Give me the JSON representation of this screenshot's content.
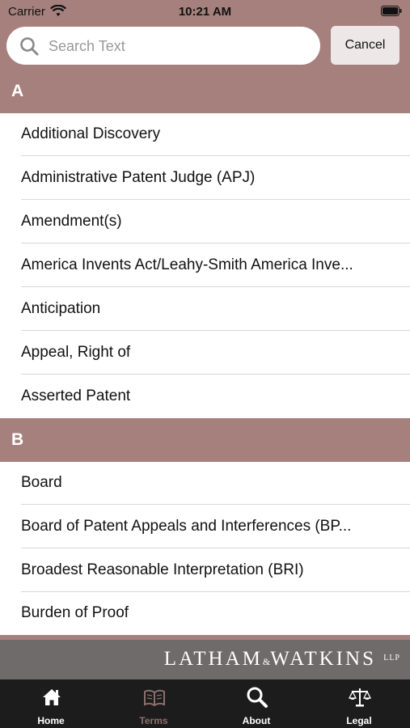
{
  "status": {
    "carrier": "Carrier",
    "time": "10:21 AM"
  },
  "search": {
    "placeholder": "Search Text",
    "value": "",
    "cancel_label": "Cancel"
  },
  "sections": [
    {
      "letter": "A",
      "items": [
        "Additional Discovery",
        "Administrative Patent Judge (APJ)",
        "Amendment(s)",
        "America Invents Act/Leahy-Smith America Inve...",
        "Anticipation",
        "Appeal, Right of",
        "Asserted Patent"
      ]
    },
    {
      "letter": "B",
      "items": [
        "Board",
        "Board of Patent Appeals and Interferences (BP...",
        "Broadest Reasonable Interpretation (BRI)",
        "Burden of Proof"
      ]
    }
  ],
  "brand": {
    "name_left": "LATHAM",
    "amp": "&",
    "name_right": "WATKINS",
    "suffix": "LLP"
  },
  "tabs": [
    {
      "label": "Home",
      "icon": "home-icon",
      "active": false
    },
    {
      "label": "Terms",
      "icon": "book-icon",
      "active": true
    },
    {
      "label": "About",
      "icon": "search-icon",
      "active": false
    },
    {
      "label": "Legal",
      "icon": "scales-icon",
      "active": false
    }
  ],
  "colors": {
    "accent": "#a5807c",
    "brand_bar": "#6f6b6a",
    "tabbar": "#1c1c1c",
    "active_tab": "#8d6f6b"
  }
}
